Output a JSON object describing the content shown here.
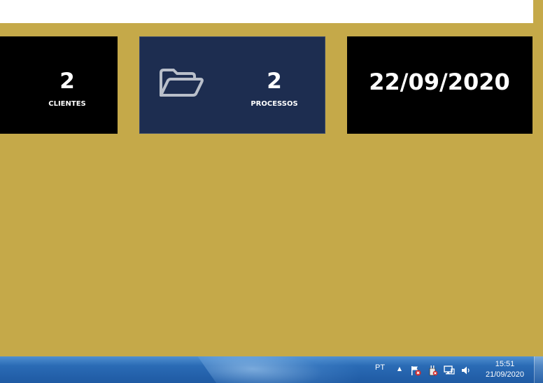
{
  "cards": {
    "clientes": {
      "value": "2",
      "label": "CLIENTES"
    },
    "processos": {
      "value": "2",
      "label": "PROCESSOS",
      "icon": "folder-open-icon"
    },
    "date": {
      "value": "22/09/2020"
    }
  },
  "colors": {
    "background": "#c5a949",
    "card_dark": "#000000",
    "card_navy": "#1d2d50",
    "text": "#ffffff"
  },
  "taskbar": {
    "language": "PT",
    "tray_icons": [
      "show-hidden-icons-icon",
      "action-center-flag-icon",
      "power-icon",
      "network-icon",
      "volume-icon"
    ],
    "time": "15:51",
    "date": "21/09/2020"
  }
}
